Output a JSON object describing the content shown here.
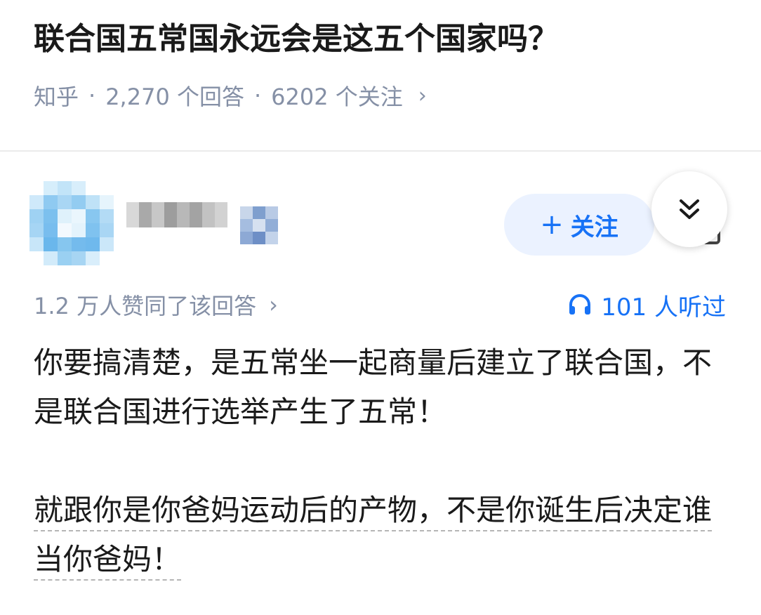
{
  "question": {
    "title": "联合国五常国永远会是这五个国家吗？",
    "source": "知乎",
    "answers": "2,270 个回答",
    "followers": "6202 个关注",
    "separator": "·",
    "chevron": "›"
  },
  "author": {
    "follow_plus": "+",
    "follow_label": "关注"
  },
  "stats": {
    "votes": "1.2 万人赞同了该回答",
    "chevron": "›",
    "listen": "101 人听过"
  },
  "answer": {
    "para1": "你要搞清楚，是五常坐一起商量后建立了联合国，不是联合国进行选举产生了五常！",
    "para2": "就跟你是你爸妈运动后的产物，不是你诞生后决定谁当你爸妈！"
  },
  "icons": {
    "collapse": "double-chevron-down-icon",
    "listen": "headphones-icon"
  },
  "colors": {
    "accent": "#1772f6",
    "meta": "#8590a6",
    "follow_bg": "#ebf2ff"
  }
}
